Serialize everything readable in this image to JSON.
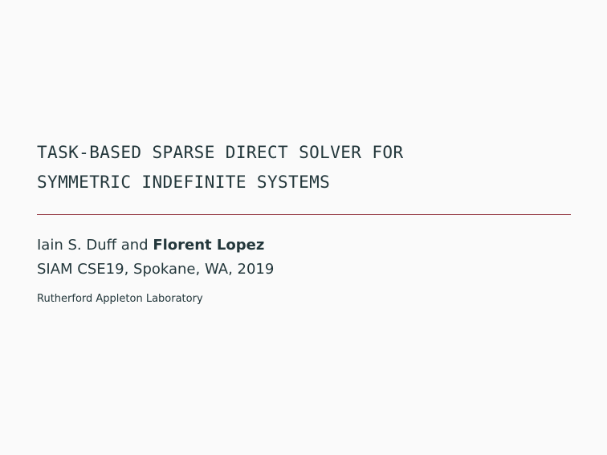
{
  "slide": {
    "title_lines": [
      "TASK-BASED SPARSE DIRECT SOLVER FOR",
      "SYMMETRIC INDEFINITE SYSTEMS"
    ],
    "authors": {
      "coauthor": "Iain S. Duff",
      "conjunction": " and ",
      "presenter": "Florent Lopez"
    },
    "event": "SIAM CSE19, Spokane, WA, 2019",
    "institute": "Rutherford Appleton Laboratory"
  },
  "colors": {
    "background": "#fafafa",
    "text": "#23373b",
    "rule": "#8a2430"
  }
}
